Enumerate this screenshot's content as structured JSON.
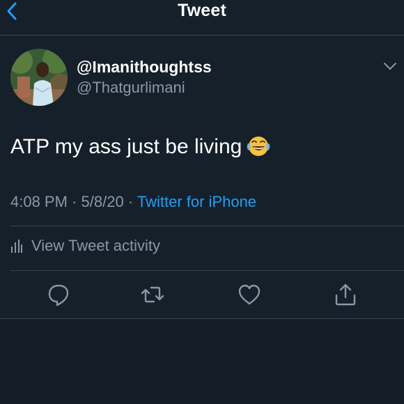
{
  "header": {
    "title": "Tweet",
    "back_icon": "chevron-left-icon"
  },
  "tweet": {
    "display_name": "@Imanithoughtss",
    "handle": "@Thatgurlimani",
    "text": "ATP my ass just be living",
    "emoji": "face-with-tears-of-joy",
    "time": "4:08 PM",
    "date": "5/8/20",
    "separator": "·",
    "source": "Twitter for iPhone"
  },
  "activity": {
    "label": "View Tweet activity",
    "icon": "bar-chart-icon"
  },
  "actions": [
    "reply-icon",
    "retweet-icon",
    "like-icon",
    "share-icon"
  ],
  "colors": {
    "background": "#15202b",
    "divider": "#38444d",
    "secondary_text": "#8899a6",
    "accent": "#1da1f2"
  }
}
